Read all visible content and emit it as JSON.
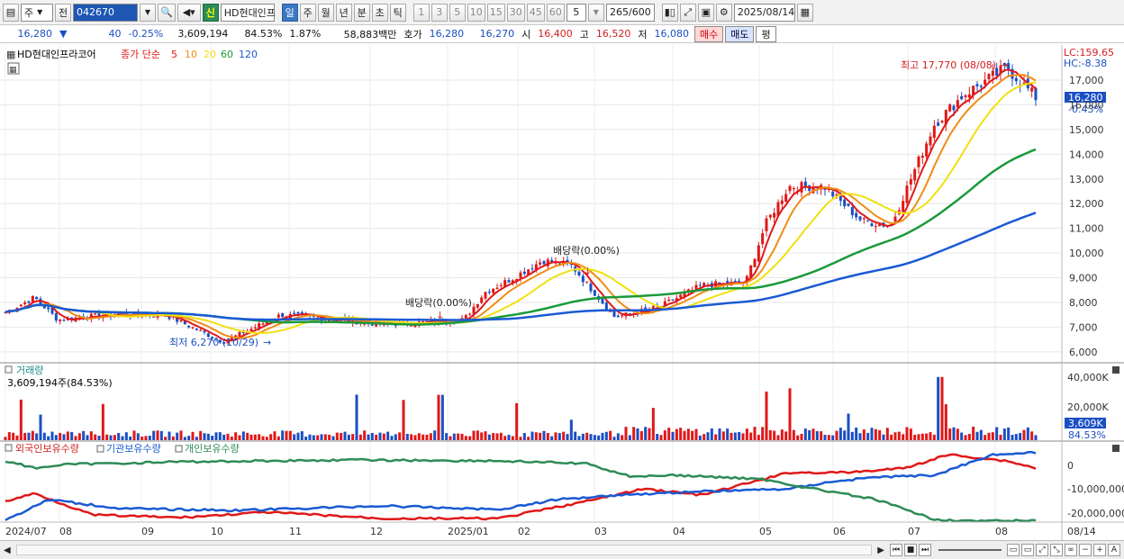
{
  "toolbar": {
    "market": "주",
    "prev": "전",
    "code": "042670",
    "name": "HD현대인프",
    "shin": "신",
    "periods": [
      "일",
      "주",
      "월",
      "년",
      "분",
      "초",
      "틱"
    ],
    "active_period": "일",
    "intervals": [
      "1",
      "3",
      "5",
      "10",
      "15",
      "30",
      "45",
      "60"
    ],
    "interval_value": "5",
    "count": "265",
    "count_total": "/600",
    "date": "2025/08/14"
  },
  "quote": {
    "price": "16,280",
    "change": "40",
    "change_pct": "-0.25%",
    "volume": "3,609,194",
    "vol_ratio": "84.53%",
    "turnover": "1.87%",
    "amount": "58,883백만",
    "hoga_label": "호가",
    "ask": "16,280",
    "bid": "16,270",
    "open_label": "시",
    "open": "16,400",
    "high_label": "고",
    "high": "16,520",
    "low_label": "저",
    "low": "16,080",
    "buy_label": "매수",
    "sell_label": "매도",
    "avg_label": "평"
  },
  "price_panel": {
    "legend_name": "HD현대인프라코어",
    "legend_series": "종가 단순",
    "ma_periods": [
      "5",
      "10",
      "20",
      "60",
      "120"
    ],
    "ma_colors": [
      "#e01818",
      "#f08c14",
      "#f0e010",
      "#1a9a3a",
      "#1a5ad4"
    ],
    "lc": "LC:159.65",
    "hc": "HC:-8.38",
    "cur_price": "16,280",
    "cur_pct": "-0.43%",
    "y_ticks": [
      "17,000",
      "16,000",
      "15,000",
      "14,000",
      "13,000",
      "12,000",
      "11,000",
      "10,000",
      "9,000",
      "8,000",
      "7,000",
      "6,000"
    ],
    "high_annotation": "최고 17,770 (08/08)",
    "low_annotation": "최저 6,270 (10/29)",
    "dividend_1": "배당락(0.00%)",
    "dividend_2": "배당락(0.00%)"
  },
  "volume_panel": {
    "title": "거래량",
    "value": "3,609,194주(84.53%)",
    "y_ticks": [
      "40,000K",
      "20,000K"
    ],
    "cur": "3,609K",
    "cur_pct": "84.53%"
  },
  "holding_panel": {
    "series": [
      "외국인보유수량",
      "기관보유수량",
      "개인보유수량"
    ],
    "colors": [
      "#e01818",
      "#1a5ad4",
      "#2e8b57"
    ],
    "y_ticks": [
      "0",
      "-10,000,000",
      "-20,000,000"
    ]
  },
  "x_axis": [
    "2024/07",
    "08",
    "09",
    "10",
    "11",
    "12",
    "2025/01",
    "02",
    "03",
    "04",
    "05",
    "06",
    "07",
    "08"
  ],
  "x_axis_right": "08/14"
}
